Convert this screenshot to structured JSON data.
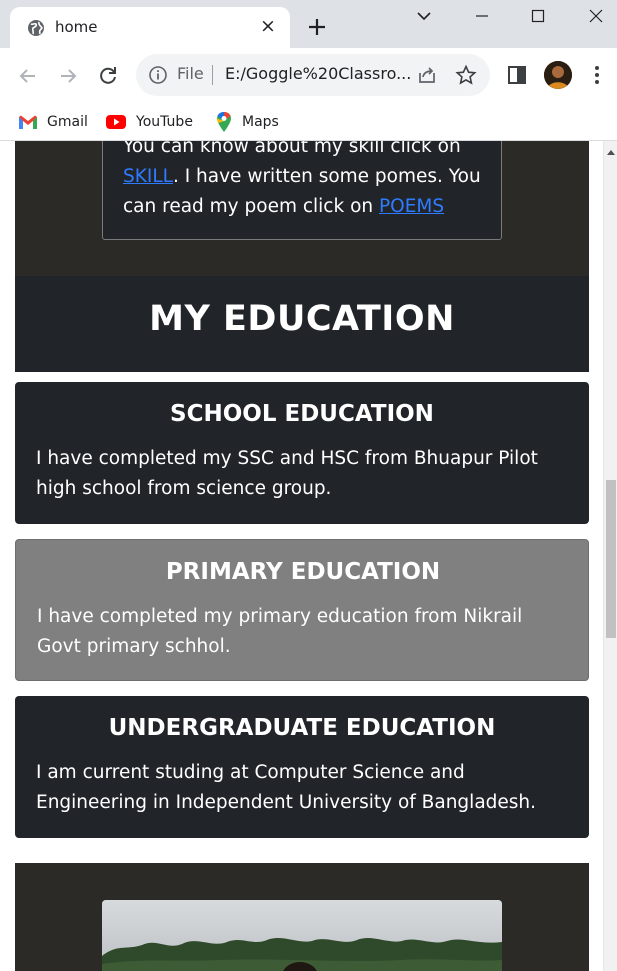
{
  "browser": {
    "tab_title": "home",
    "close_glyph": "×",
    "omnibox": {
      "scheme_label": "File",
      "url": "E:/Goggle%20Classro..."
    },
    "bookmarks": [
      {
        "label": "Gmail",
        "icon": "gmail-icon"
      },
      {
        "label": "YouTube",
        "icon": "youtube-icon"
      },
      {
        "label": "Maps",
        "icon": "maps-icon"
      }
    ]
  },
  "about": {
    "line1": "You can know about my skill click on ",
    "skill_link": "SKILL",
    "line2": ". I have written some pomes. You can read my poem click on ",
    "poems_link": "POEMS"
  },
  "education": {
    "heading": "MY EDUCATION",
    "cards": [
      {
        "title": "SCHOOL EDUCATION",
        "text": "I have completed my SSC and HSC from Bhuapur Pilot high school from science group.",
        "style": "dark"
      },
      {
        "title": "PRIMARY EDUCATION",
        "text": "I have completed my primary education from Nikrail Govt primary schhol.",
        "style": "grey"
      },
      {
        "title": "UNDERGRADUATE EDUCATION",
        "text": "I am current studing at Computer Science and Engineering in Independent University of Bangladesh.",
        "style": "dark"
      }
    ]
  },
  "colors": {
    "section_dark": "#212529",
    "section_brown": "#2b2a27",
    "card_grey": "#808080",
    "link": "#2f7bff"
  }
}
